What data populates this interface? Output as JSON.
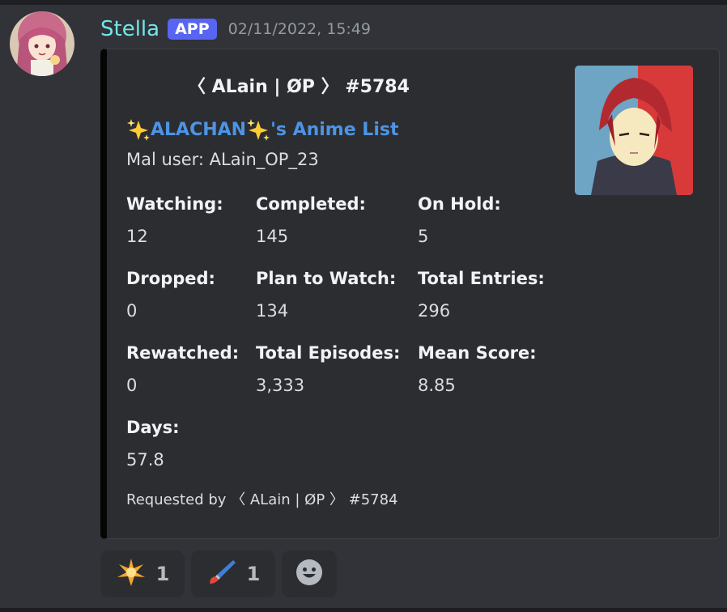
{
  "message": {
    "username": "Stella",
    "badge": "APP",
    "timestamp": "02/11/2022, 15:49"
  },
  "embed": {
    "author": "〈 ALain | ØP 〉 #5784",
    "title_sparkle_left": "✨",
    "title_main": "ALACHAN",
    "title_sparkle_right": "✨",
    "title_suffix": "'s Anime List",
    "description": "Mal user: ALain_OP_23",
    "fields": [
      {
        "name": "Watching:",
        "value": "12"
      },
      {
        "name": "Completed:",
        "value": "145"
      },
      {
        "name": "On Hold:",
        "value": "5"
      },
      {
        "name": "Dropped:",
        "value": "0"
      },
      {
        "name": "Plan to Watch:",
        "value": "134"
      },
      {
        "name": "Total Entries:",
        "value": "296"
      },
      {
        "name": "Rewatched:",
        "value": "0"
      },
      {
        "name": "Total Episodes:",
        "value": "3,333"
      },
      {
        "name": "Mean Score:",
        "value": "8.85"
      },
      {
        "name": "Days:",
        "value": "57.8"
      }
    ],
    "footer": "Requested by 〈 ALain | ØP 〉 #5784",
    "accent_color": "#050505"
  },
  "reactions": [
    {
      "icon": "glowing-star-icon",
      "count": "1"
    },
    {
      "icon": "paintbrush-icon",
      "count": "1"
    },
    {
      "icon": "add-reaction-smiley-icon"
    }
  ],
  "colors": {
    "username": "#74e5e8",
    "badge": "#5865f2",
    "title_link": "#4d94e4",
    "background": "#313338",
    "embed_background": "#2b2d31"
  }
}
